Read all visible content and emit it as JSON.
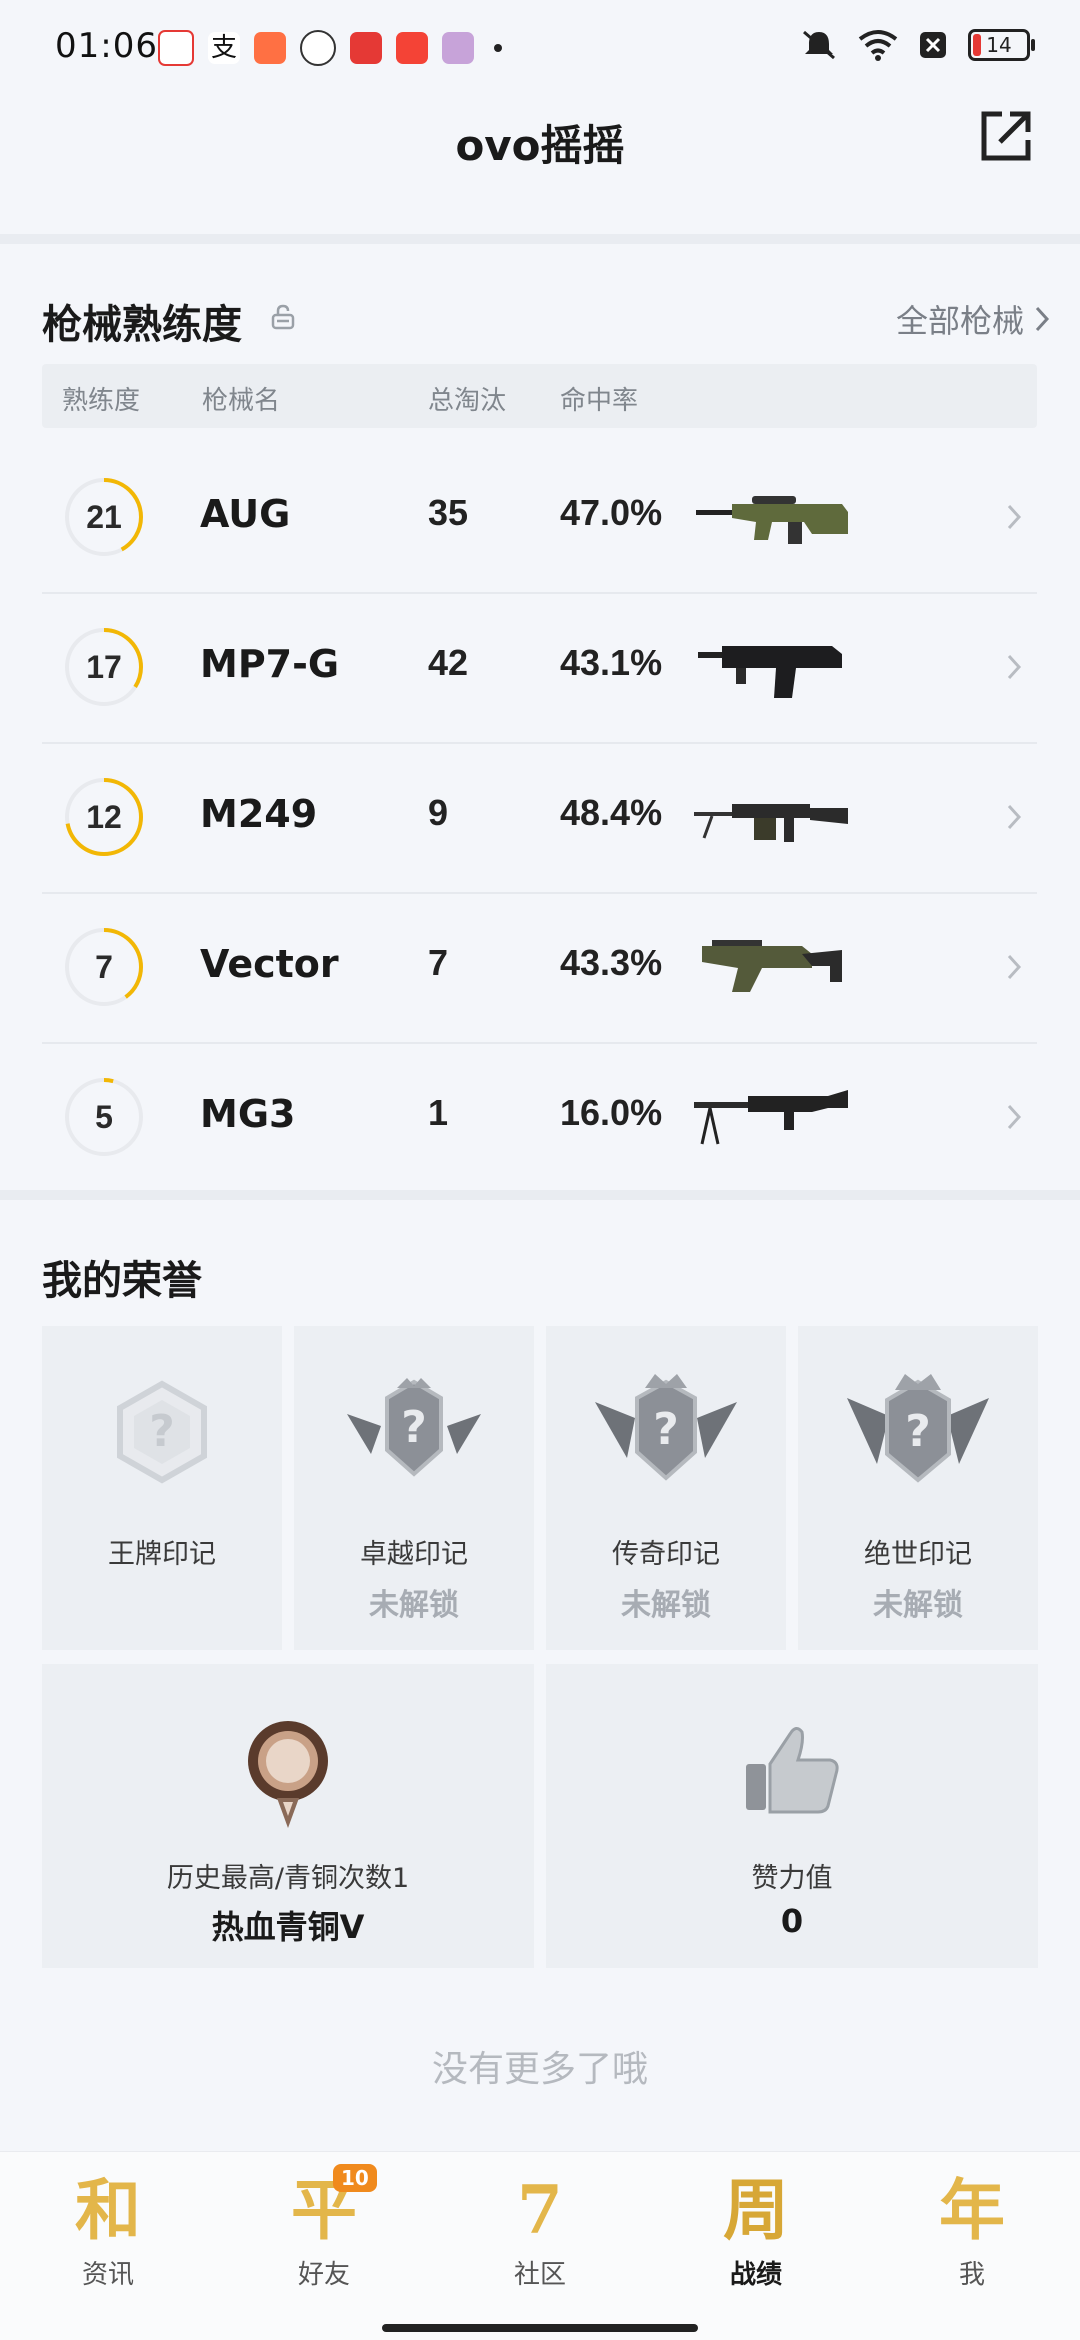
{
  "status_bar": {
    "time": "01:06",
    "battery": "14"
  },
  "header": {
    "title": "ovo摇摇"
  },
  "weapons": {
    "title": "枪械熟练度",
    "all_link": "全部枪械",
    "columns": {
      "proficiency": "熟练度",
      "name": "枪械名",
      "kills": "总淘汰",
      "accuracy": "命中率"
    },
    "rows": [
      {
        "proficiency": "21",
        "progress": 0.42,
        "name": "AUG",
        "kills": "35",
        "accuracy": "47.0%"
      },
      {
        "proficiency": "17",
        "progress": 0.34,
        "name": "MP7-G",
        "kills": "42",
        "accuracy": "43.1%"
      },
      {
        "proficiency": "12",
        "progress": 0.72,
        "name": "M249",
        "kills": "9",
        "accuracy": "48.4%"
      },
      {
        "proficiency": "7",
        "progress": 0.4,
        "name": "Vector",
        "kills": "7",
        "accuracy": "43.3%"
      },
      {
        "proficiency": "5",
        "progress": 0.04,
        "name": "MG3",
        "kills": "1",
        "accuracy": "16.0%"
      }
    ]
  },
  "honors": {
    "title": "我的荣誉",
    "marks": [
      {
        "name": "王牌印记",
        "status": ""
      },
      {
        "name": "卓越印记",
        "status": "未解锁"
      },
      {
        "name": "传奇印记",
        "status": "未解锁"
      },
      {
        "name": "绝世印记",
        "status": "未解锁"
      }
    ],
    "rank": {
      "label": "历史最高/青铜次数1",
      "value": "热血青铜V"
    },
    "effort": {
      "label": "赞力值",
      "value": "0"
    }
  },
  "footer": {
    "no_more": "没有更多了哦"
  },
  "tabs": [
    {
      "glyph": "和",
      "label": "资讯",
      "active": false
    },
    {
      "glyph": "平",
      "label": "好友",
      "active": false,
      "badge": "10"
    },
    {
      "glyph": "7",
      "label": "社区",
      "active": false
    },
    {
      "glyph": "周",
      "label": "战绩",
      "active": true
    },
    {
      "glyph": "年",
      "label": "我",
      "active": false
    }
  ],
  "colors": {
    "accent": "#f2b705",
    "ring_track": "#e8eaee",
    "tab_gold": "#e3b64a"
  }
}
